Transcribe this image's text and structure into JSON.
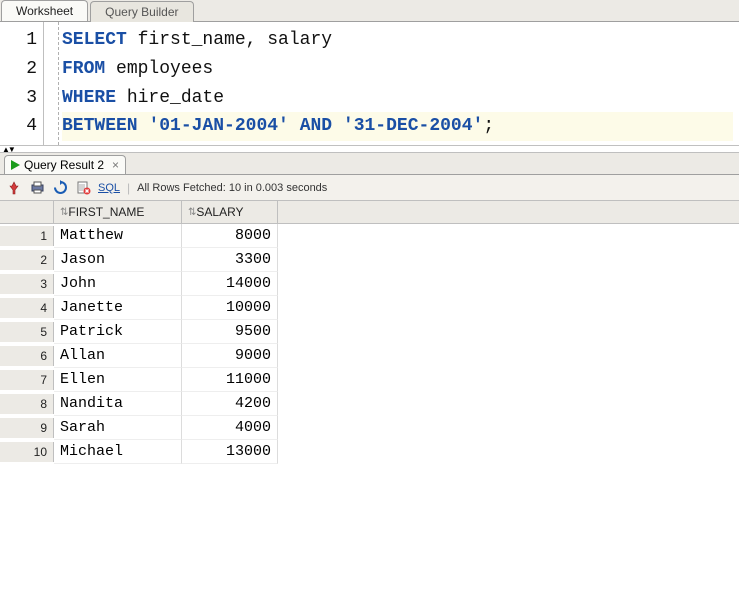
{
  "tabs": {
    "worksheet": "Worksheet",
    "query_builder": "Query Builder"
  },
  "editor": {
    "lines": [
      {
        "num": "1",
        "tokens": [
          [
            "kw",
            "SELECT"
          ],
          [
            "norm",
            " first_name, salary"
          ]
        ]
      },
      {
        "num": "2",
        "tokens": [
          [
            "kw",
            "FROM"
          ],
          [
            "norm",
            " employees"
          ]
        ]
      },
      {
        "num": "3",
        "tokens": [
          [
            "kw",
            "WHERE"
          ],
          [
            "norm",
            " hire_date"
          ]
        ]
      },
      {
        "num": "4",
        "current": true,
        "tokens": [
          [
            "kw",
            "BETWEEN"
          ],
          [
            "norm",
            " "
          ],
          [
            "str",
            "'01-JAN-2004'"
          ],
          [
            "norm",
            " "
          ],
          [
            "kw",
            "AND"
          ],
          [
            "norm",
            " "
          ],
          [
            "str",
            "'31-DEC-2004'"
          ],
          [
            "norm",
            ";"
          ]
        ]
      }
    ]
  },
  "result_tab": {
    "label": "Query Result 2",
    "close": "×"
  },
  "toolbar": {
    "sql_label": "SQL",
    "status": "All Rows Fetched: 10 in 0.003 seconds",
    "sep": "|"
  },
  "grid": {
    "columns": [
      {
        "key": "first_name",
        "label": "FIRST_NAME"
      },
      {
        "key": "salary",
        "label": "SALARY"
      }
    ],
    "rows": [
      {
        "n": "1",
        "first_name": "Matthew",
        "salary": "8000"
      },
      {
        "n": "2",
        "first_name": "Jason",
        "salary": "3300"
      },
      {
        "n": "3",
        "first_name": "John",
        "salary": "14000"
      },
      {
        "n": "4",
        "first_name": "Janette",
        "salary": "10000"
      },
      {
        "n": "5",
        "first_name": "Patrick",
        "salary": "9500"
      },
      {
        "n": "6",
        "first_name": "Allan",
        "salary": "9000"
      },
      {
        "n": "7",
        "first_name": "Ellen",
        "salary": "11000"
      },
      {
        "n": "8",
        "first_name": "Nandita",
        "salary": "4200"
      },
      {
        "n": "9",
        "first_name": "Sarah",
        "salary": "4000"
      },
      {
        "n": "10",
        "first_name": "Michael",
        "salary": "13000"
      }
    ]
  }
}
